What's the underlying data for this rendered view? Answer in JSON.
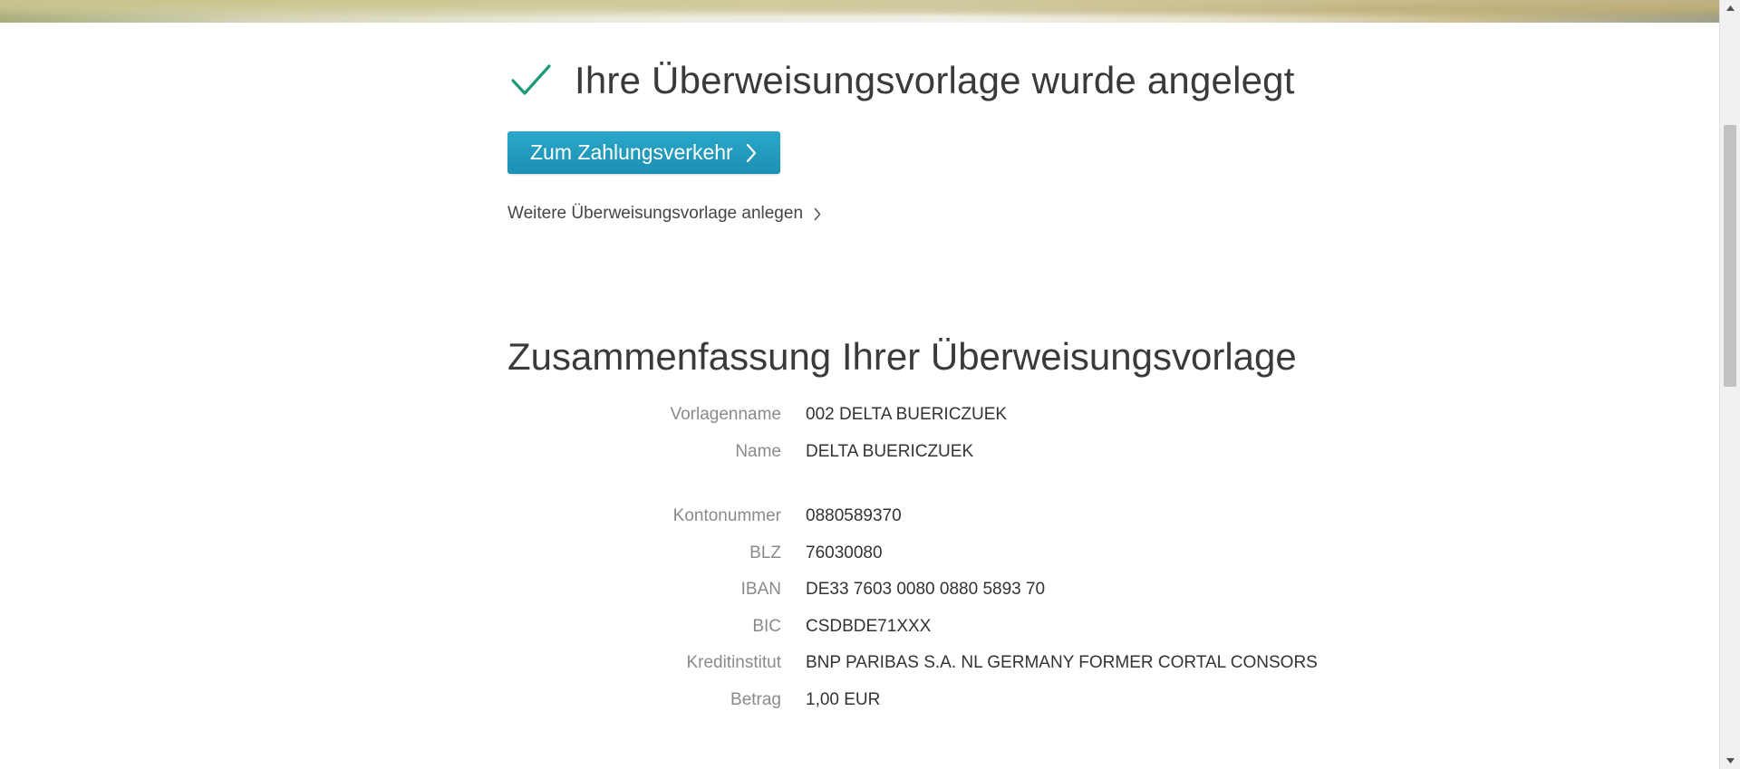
{
  "success": {
    "title": "Ihre Überweisungsvorlage wurde angelegt",
    "icon": "checkmark-icon",
    "icon_color": "#1a9a78"
  },
  "actions": {
    "primary_label": "Zum Zahlungsverkehr",
    "secondary_label": "Weitere Überweisungsvorlage anlegen"
  },
  "summary": {
    "title": "Zusammenfassung Ihrer Überweisungsvorlage",
    "rows": [
      {
        "label": "Vorlagenname",
        "value": "002 DELTA BUERICZUEK"
      },
      {
        "label": "Name",
        "value": "DELTA BUERICZUEK"
      },
      {
        "label": "Kontonummer",
        "value": "0880589370"
      },
      {
        "label": "BLZ",
        "value": "76030080"
      },
      {
        "label": "IBAN",
        "value": "DE33 7603 0080 0880 5893 70"
      },
      {
        "label": "BIC",
        "value": "CSDBDE71XXX"
      },
      {
        "label": "Kreditinstitut",
        "value": "BNP PARIBAS S.A. NL GERMANY FORMER CORTAL CONSORS"
      },
      {
        "label": "Betrag",
        "value": "1,00 EUR"
      }
    ]
  },
  "colors": {
    "accent": "#1d9cc0",
    "label": "#8a8a8a",
    "text": "#333333"
  }
}
